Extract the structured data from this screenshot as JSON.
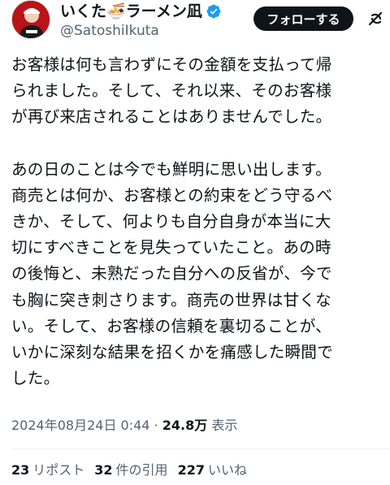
{
  "author": {
    "display_name": "いくた🍜ラーメン凪",
    "handle": "@SatoshiIkuta",
    "verified": true,
    "avatar_icon": "avatar-icon",
    "verified_color": "#1d9bf0"
  },
  "follow_button_label": "フォローする",
  "tweet": {
    "paragraph1": [
      "お客様は何も言わずにその金額を支払って帰",
      "られました。そして、それ以来、そのお客様",
      "が再び来店されることはありませんでした。"
    ],
    "paragraph2": [
      "あの日のことは今でも鮮明に思い出します。",
      "商売とは何か、お客様との約束をどう守るべ",
      "きか、そして、何よりも自分自身が本当に大",
      "切にすべきことを見失っていたこと。あの時",
      "の後悔と、未熟だった自分への反省が、今で",
      "も胸に突き刺さります。商売の世界は甘くな",
      "い。そして、お客様の信頼を裏切ることが、",
      "いかに深刻な結果を招くかを痛感した瞬間で",
      "した。"
    ]
  },
  "meta": {
    "timestamp": "2024年08月24日 0:44",
    "separator": "·",
    "views_count": "24.8万",
    "views_label": "表示"
  },
  "stats": {
    "reposts_count": "23",
    "reposts_label": "リポスト",
    "quotes_count": "32",
    "quotes_label": "件の引用",
    "likes_count": "227",
    "likes_label": "いいね"
  }
}
